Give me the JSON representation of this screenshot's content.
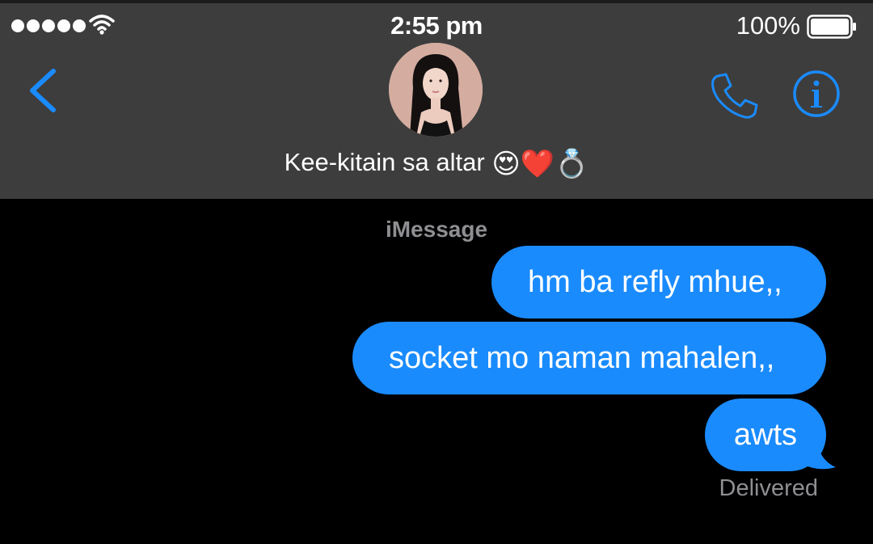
{
  "status_bar": {
    "time": "2:55 pm",
    "battery_percent": "100%",
    "signal_bars": 5,
    "icons": [
      "signal-dots-icon",
      "wifi-icon",
      "battery-icon"
    ]
  },
  "header": {
    "contact_name": "Kee-kitain sa altar",
    "contact_emojis": "😍❤️💍",
    "icons": [
      "back-chevron-icon",
      "phone-icon",
      "info-icon"
    ],
    "accent_color": "#1a8bfd"
  },
  "conversation": {
    "service_label": "iMessage",
    "messages": [
      {
        "text": "hm ba refly mhue,,",
        "sender": "me"
      },
      {
        "text": "socket mo naman mahalen,,",
        "sender": "me"
      },
      {
        "text": "awts",
        "sender": "me"
      }
    ],
    "status": "Delivered"
  },
  "colors": {
    "bubble": "#1a8bfd",
    "header_bg": "#3d3d3d",
    "background": "#000000",
    "muted_text": "#8e8e93"
  }
}
